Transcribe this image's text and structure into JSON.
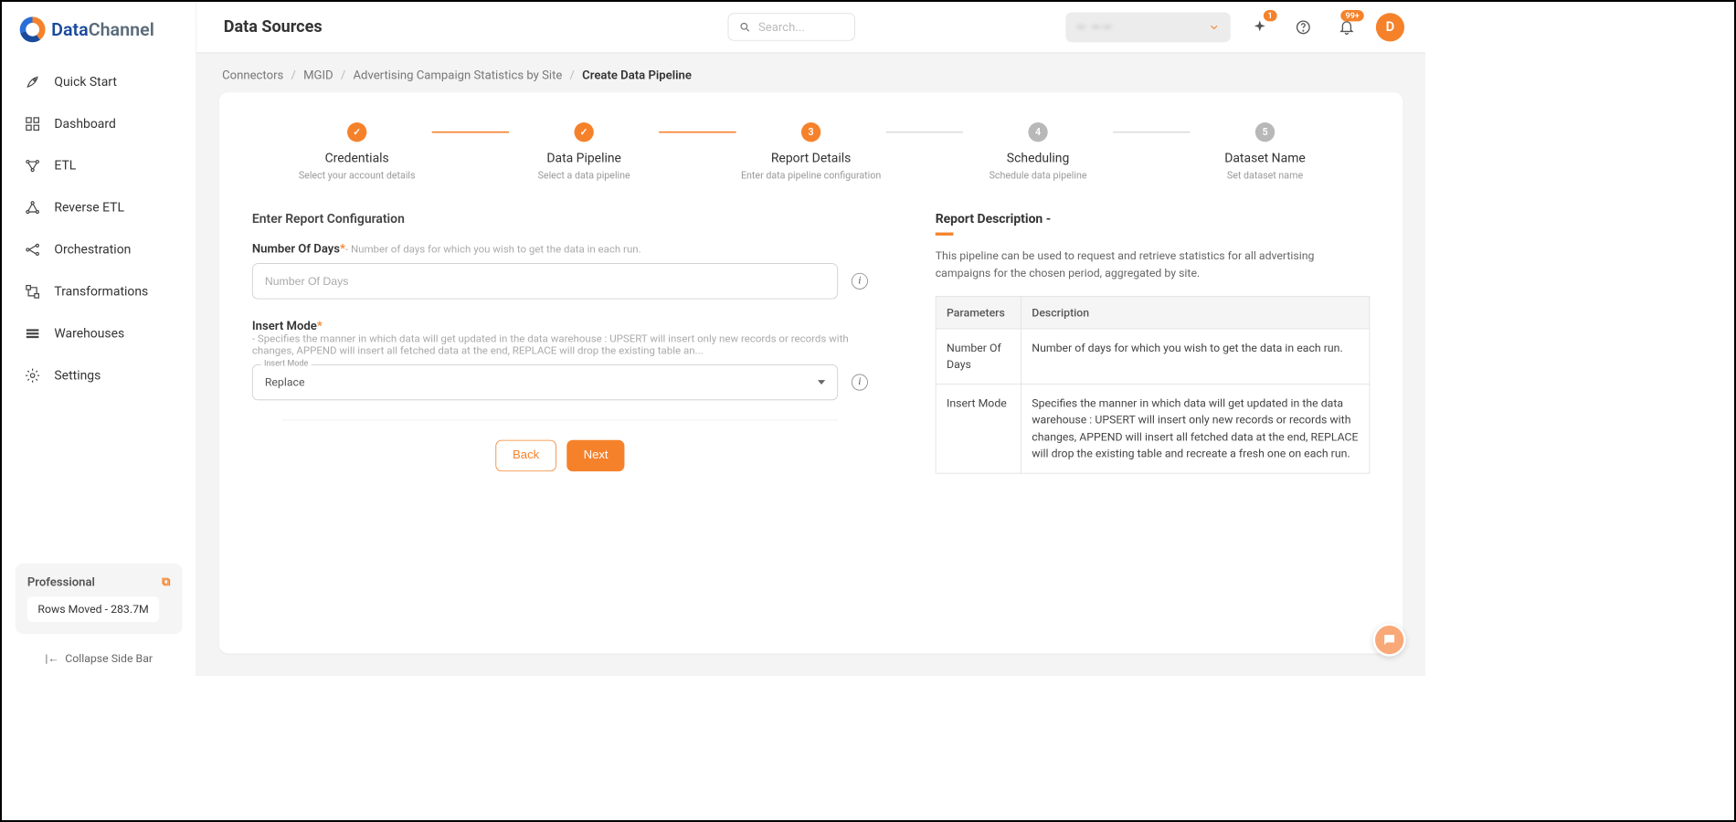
{
  "brand": {
    "part1": "Data",
    "part2": "Channel"
  },
  "sidebar": {
    "items": [
      {
        "label": "Quick Start",
        "icon": "rocket"
      },
      {
        "label": "Dashboard",
        "icon": "grid"
      },
      {
        "label": "ETL",
        "icon": "flow"
      },
      {
        "label": "Reverse ETL",
        "icon": "rflow"
      },
      {
        "label": "Orchestration",
        "icon": "orch"
      },
      {
        "label": "Transformations",
        "icon": "trans"
      },
      {
        "label": "Warehouses",
        "icon": "storage"
      },
      {
        "label": "Settings",
        "icon": "gear"
      }
    ],
    "plan": {
      "title": "Professional",
      "chip": "Rows Moved - 283.7M"
    },
    "collapse": "Collapse Side Bar"
  },
  "header": {
    "title": "Data Sources",
    "search_placeholder": "Search...",
    "account": "— ——",
    "spark_badge": "1",
    "bell_badge": "99+",
    "avatar": "D"
  },
  "crumbs": [
    "Connectors",
    "MGID",
    "Advertising Campaign Statistics by Site",
    "Create Data Pipeline"
  ],
  "stepper": [
    {
      "title": "Credentials",
      "sub": "Select your account details",
      "state": "done"
    },
    {
      "title": "Data Pipeline",
      "sub": "Select a data pipeline",
      "state": "done"
    },
    {
      "title": "Report Details",
      "sub": "Enter data pipeline configuration",
      "state": "cur",
      "num": "3"
    },
    {
      "title": "Scheduling",
      "sub": "Schedule data pipeline",
      "state": "todo",
      "num": "4"
    },
    {
      "title": "Dataset Name",
      "sub": "Set dataset name",
      "state": "todo",
      "num": "5"
    }
  ],
  "form": {
    "section": "Enter Report Configuration",
    "days": {
      "label": "Number Of Days",
      "hint": "- Number of days for which you wish to get the data in each run.",
      "placeholder": "Number Of Days"
    },
    "insert": {
      "label": "Insert Mode",
      "hint": "- Specifies the manner in which data will get updated in the data warehouse : UPSERT will insert only new records or records with changes, APPEND will insert all fetched data at the end, REPLACE will drop the existing table an...",
      "float": "Insert Mode",
      "value": "Replace"
    },
    "back": "Back",
    "next": "Next"
  },
  "desc": {
    "title": "Report Description -",
    "text": "This pipeline can be used to request and retrieve statistics for all advertising campaigns for the chosen period, aggregated by site.",
    "th1": "Parameters",
    "th2": "Description",
    "rows": [
      {
        "p": "Number Of Days",
        "d": "Number of days for which you wish to get the data in each run."
      },
      {
        "p": "Insert Mode",
        "d": "Specifies the manner in which data will get updated in the data warehouse : UPSERT will insert only new records or records with changes, APPEND will insert all fetched data at the end, REPLACE will drop the existing table and recreate a fresh one on each run."
      }
    ]
  }
}
